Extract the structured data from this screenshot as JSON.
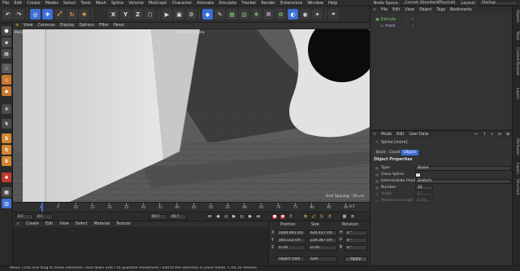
{
  "menubar": {
    "items": [
      "File",
      "Edit",
      "Create",
      "Modes",
      "Select",
      "Tools",
      "Mesh",
      "Spline",
      "Volume",
      "MoGraph",
      "Character",
      "Animate",
      "Simulate",
      "Tracker",
      "Render",
      "Extensions",
      "Window",
      "Help"
    ],
    "node_space_label": "Node Space:",
    "node_space_value": "Current (Standard/Physical)",
    "layout_label": "Layout:",
    "layout_value": "Startup"
  },
  "toolbar": {
    "axis_x": "X",
    "axis_y": "Y",
    "axis_z": "Z"
  },
  "viewport": {
    "menu": [
      "View",
      "Cameras",
      "Display",
      "Options",
      "Filter",
      "Panel"
    ],
    "projection_label": "Perspective",
    "camera_label": "Default Camera",
    "grid_spacing": "Grid Spacing : 50 cm"
  },
  "timeline": {
    "ticks": [
      "0",
      "5",
      "10",
      "15",
      "20",
      "25",
      "30",
      "35",
      "40",
      "45",
      "50",
      "55",
      "60",
      "65",
      "70",
      "75",
      "80",
      "85",
      "90"
    ],
    "end_label": "0 F"
  },
  "transport": {
    "current_frame": "0 F",
    "min_frame": "0 F",
    "max_frame": "90 F",
    "preview_max": "90 F"
  },
  "material_manager": {
    "menu": [
      "Create",
      "Edit",
      "View",
      "Select",
      "Material",
      "Texture"
    ]
  },
  "coordinates": {
    "headers": [
      "Position",
      "Size",
      "Rotation"
    ],
    "rows": [
      {
        "axis": "X",
        "position": "1044.991 cm",
        "size": "624.417 cm",
        "rot_axis": "H",
        "rotation": "0 °"
      },
      {
        "axis": "Y",
        "position": "165.512 cm",
        "size": "224.367 cm",
        "rot_axis": "P",
        "rotation": "0 °"
      },
      {
        "axis": "Z",
        "position": "0 cm",
        "size": "0 cm",
        "rot_axis": "B",
        "rotation": "0 °"
      }
    ],
    "mode_select": "Object (Rel)",
    "size_select": "Size",
    "apply_label": "Apply"
  },
  "object_manager": {
    "menu": [
      "File",
      "Edit",
      "View",
      "Object",
      "Tags",
      "Bookmarks"
    ],
    "objects": [
      {
        "name": "Extrude",
        "color": "#79c36a"
      },
      {
        "name": "moro",
        "color": "#c7a0e0"
      }
    ]
  },
  "attribute_manager": {
    "menu": [
      "Mode",
      "Edit",
      "User Data"
    ],
    "object_title": "Spline [moro]",
    "tabs": [
      "Basic",
      "Coord.",
      "Object"
    ],
    "active_tab": "Object",
    "section": "Object Properties",
    "rows": [
      {
        "label": "Type",
        "value": "Bezier",
        "kind": "select"
      },
      {
        "label": "Close Spline",
        "value": "✓",
        "kind": "check"
      },
      {
        "label": "Intermediate Points",
        "value": "Uniform",
        "kind": "select"
      },
      {
        "label": "Number",
        "value": "40",
        "kind": "number"
      },
      {
        "label": "Angle",
        "value": "5 °",
        "kind": "number"
      },
      {
        "label": "Maximum Length",
        "value": "5 cm",
        "kind": "number"
      }
    ]
  },
  "right_tabs": [
    "Objects",
    "Takes",
    "Content Browser",
    "Layers"
  ],
  "right_tabs_lower": [
    "Attributes",
    "Layers",
    "Structure"
  ],
  "status": "Move: Click and drag to move elements. Hold down SHIFT to quantize movement / add to the selection in point mode, CTRL to remove.",
  "colors": {
    "accent": "#e8a13a",
    "highlight": "#3d6fd6",
    "spline_green": "#79c36a"
  }
}
